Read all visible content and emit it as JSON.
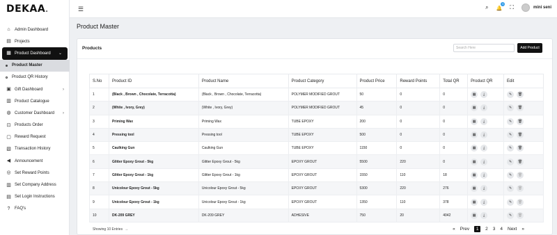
{
  "brand": {
    "name": "DEKAA",
    "dot": "."
  },
  "sidebar": {
    "items": [
      {
        "label": "Admin Dashboard",
        "icon": "home-icon",
        "glyph": "⌂"
      },
      {
        "label": "Projects",
        "icon": "clipboard-icon",
        "glyph": "▤"
      },
      {
        "label": "Product Dashboard",
        "icon": "grid-icon",
        "glyph": "▦",
        "chevron": "⌄"
      },
      {
        "label": "Product Master",
        "icon": "bullet",
        "sub": true
      },
      {
        "label": "Product QR History",
        "icon": "bullet",
        "sub": true
      },
      {
        "label": "Gift Dashboard",
        "icon": "gift-icon",
        "glyph": "▣",
        "chevron": "›"
      },
      {
        "label": "Product Catalogue",
        "icon": "book-icon",
        "glyph": "▥"
      },
      {
        "label": "Customer Dashboard",
        "icon": "people-icon",
        "glyph": "◍",
        "chevron": "›"
      },
      {
        "label": "Products Order",
        "icon": "cart-icon",
        "glyph": "⊡"
      },
      {
        "label": "Reward Request",
        "icon": "gift-box-icon",
        "glyph": "▢"
      },
      {
        "label": "Transaction History",
        "icon": "receipt-icon",
        "glyph": "▧"
      },
      {
        "label": "Announcement",
        "icon": "megaphone-icon",
        "glyph": "◀"
      },
      {
        "label": "Set Reward Points",
        "icon": "coins-icon",
        "glyph": "◎"
      },
      {
        "label": "Set Company Address",
        "icon": "building-icon",
        "glyph": "▥"
      },
      {
        "label": "Set Login Instructions",
        "icon": "instructions-icon",
        "glyph": "▤"
      },
      {
        "label": "FAQ's",
        "icon": "question-icon",
        "glyph": "?"
      }
    ]
  },
  "topbar": {
    "menu_icon": "☰",
    "search_icon": "⌕",
    "bell_icon": "🔔",
    "notif_count": "0",
    "fullscreen_icon": "⛶",
    "user_name": "mini seni"
  },
  "page": {
    "title": "Product Master"
  },
  "card": {
    "title": "Products",
    "search_placeholder": "Search Here",
    "add_button": "Add Product"
  },
  "table": {
    "headers": [
      "S.No",
      "Product ID",
      "Product Name",
      "Product Category",
      "Product Price",
      "Reward Points",
      "Total QR",
      "Product QR",
      "Edit"
    ],
    "rows": [
      [
        "1",
        "(Black , Brown , Chocolate, Terracotta)",
        "(Black , Brown , Chocolate, Terracotta)",
        "POLYMER MODIFIED GROUT",
        "50",
        "0",
        "0"
      ],
      [
        "2",
        "(White , Ivory, Grey)",
        "(White , Ivory, Grey)",
        "POLYMER MODIFIED GROUT",
        "45",
        "0",
        "0"
      ],
      [
        "3",
        "Priming Wax",
        "Priming Wax",
        "TUBE EPOXY",
        "200",
        "0",
        "0"
      ],
      [
        "4",
        "Pressing tool",
        "Pressing tool",
        "TUBE EPOXY",
        "500",
        "0",
        "0"
      ],
      [
        "5",
        "Caulking Gun",
        "Caulking Gun",
        "TUBE EPOXY",
        "1150",
        "0",
        "0"
      ],
      [
        "6",
        "Glitter Epoxy Grout - 5kg",
        "Glitter Epoxy Grout - 5kg",
        "EPOXY GROUT",
        "5500",
        "220",
        "0"
      ],
      [
        "7",
        "Glitter Epoxy Grout - 1kg",
        "Glitter Epoxy Grout - 1kg",
        "EPOXY GROUT",
        "1550",
        "110",
        "18"
      ],
      [
        "8",
        "Unicolour Epoxy Grout - 5kg",
        "Unicolour Epoxy Grout - 5kg",
        "EPOXY GROUT",
        "5300",
        "220",
        "276"
      ],
      [
        "9",
        "Unicolour Epoxy Grout - 1kg",
        "Unicolour Epoxy Grout - 1kg",
        "EPOXY GROUT",
        "1350",
        "110",
        "378"
      ],
      [
        "10",
        "DK-209 GREY",
        "DK-209 GREY",
        "ADHESIVE",
        "750",
        "20",
        "4042"
      ]
    ],
    "delete_disabled_rows": [
      7,
      8,
      9,
      10
    ]
  },
  "footer": {
    "showing": "Showing 10 Entries",
    "arrow": "→",
    "prev_arrow": "«",
    "prev": "Prev",
    "pages": [
      "1",
      "2",
      "3",
      "4"
    ],
    "next": "Next",
    "next_arrow": "»"
  }
}
